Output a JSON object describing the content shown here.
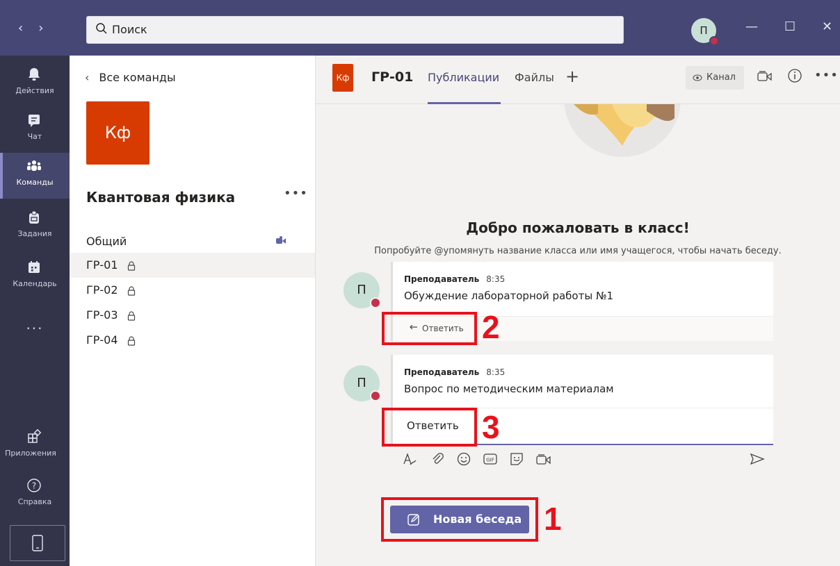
{
  "titlebar": {
    "search_placeholder": "Поиск",
    "user_initial": "П"
  },
  "rail": {
    "items": [
      {
        "label": "Действия",
        "icon": "bell-icon"
      },
      {
        "label": "Чат",
        "icon": "chat-icon"
      },
      {
        "label": "Команды",
        "icon": "teams-icon",
        "active": true
      },
      {
        "label": "Задания",
        "icon": "assignments-icon"
      },
      {
        "label": "Календарь",
        "icon": "calendar-icon"
      }
    ],
    "more": "...",
    "bottom": [
      {
        "label": "Приложения",
        "icon": "apps-icon"
      },
      {
        "label": "Справка",
        "icon": "help-icon"
      }
    ]
  },
  "teams_panel": {
    "back_label": "Все команды",
    "team_initials": "Кф",
    "team_name": "Квантовая физика",
    "more": "•••",
    "channels": [
      {
        "name": "Общий",
        "locked": false
      },
      {
        "name": "ГР-01",
        "locked": true,
        "active": true
      },
      {
        "name": "ГР-02",
        "locked": true
      },
      {
        "name": "ГР-03",
        "locked": true
      },
      {
        "name": "ГР-04",
        "locked": true
      }
    ]
  },
  "channel_header": {
    "logo_initials": "Кф",
    "name": "ГР-01",
    "tabs": [
      "Публикации",
      "Файлы"
    ],
    "add": "+",
    "channel_button": "Канал",
    "more": "•••"
  },
  "feed": {
    "welcome_title": "Добро пожаловать в класс!",
    "welcome_subtitle": "Попробуйте @упомянуть название класса или имя учащегося, чтобы начать беседу.",
    "posts": [
      {
        "author": "Преподаватель",
        "time": "8:35",
        "message": "Обуждение лабораторной работы №1",
        "reply_label": "Ответить",
        "avatar": "П"
      },
      {
        "author": "Преподаватель",
        "time": "8:35",
        "message": "Вопрос по методическим материалам",
        "reply_label": "Ответить",
        "avatar": "П"
      }
    ],
    "new_conversation_label": "Новая беседа"
  },
  "annotations": [
    "1",
    "2",
    "3"
  ],
  "colors": {
    "titlebar": "#464775",
    "rail": "#33344a",
    "accent": "#6264a7",
    "team_logo": "#d83b01",
    "annotation": "#e8121b",
    "status_busy": "#c4314b"
  }
}
